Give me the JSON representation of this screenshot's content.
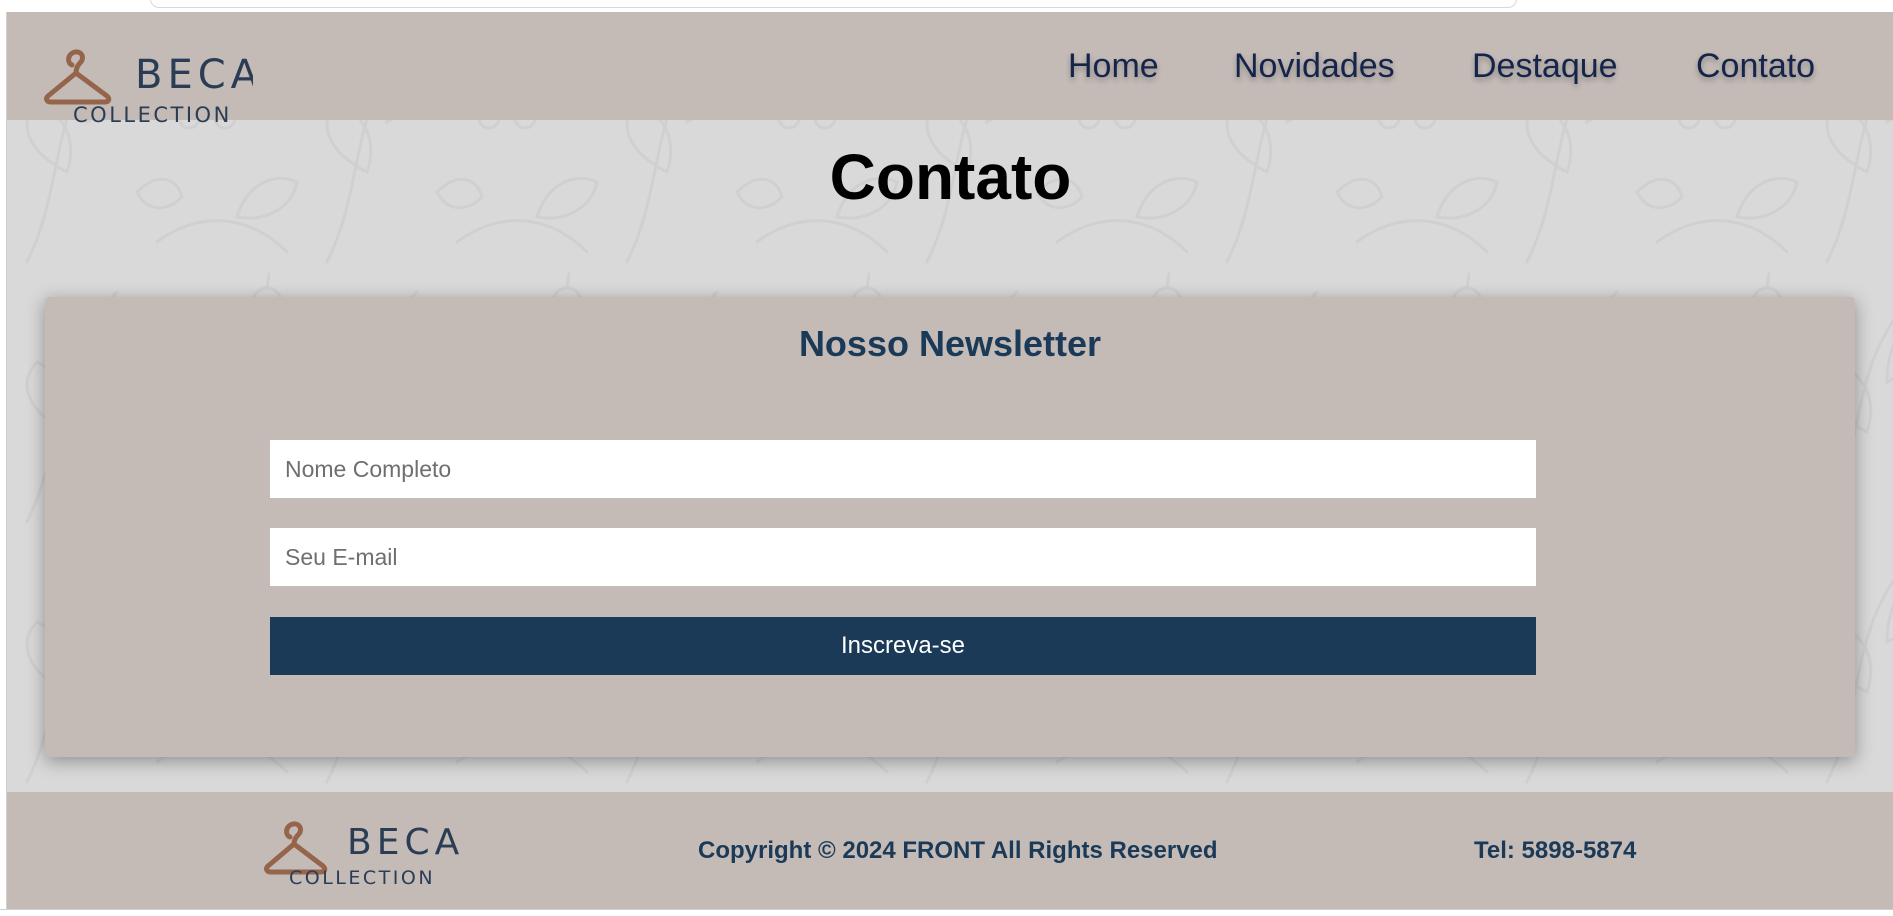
{
  "header": {
    "logo": {
      "line1": "BECA",
      "line2": "COLLECTION"
    },
    "nav": [
      "Home",
      "Novidades",
      "Destaque",
      "Contato"
    ]
  },
  "page": {
    "title": "Contato"
  },
  "newsletter": {
    "title": "Nosso Newsletter",
    "name_placeholder": "Nome Completo",
    "name_value": "",
    "email_placeholder": "Seu E-mail",
    "email_value": "",
    "submit_label": "Inscreva-se"
  },
  "footer": {
    "logo": {
      "line1": "BECA",
      "line2": "COLLECTION"
    },
    "copyright": "Copyright © 2024 FRONT All Rights Reserved",
    "phone": "Tel: 5898-5874"
  },
  "icons": {
    "logo_mark": "hanger-icon",
    "background": "floral-pattern"
  },
  "colors": {
    "header_bg": "#c4bbb7",
    "page_bg": "#d9d9d9",
    "nav_text": "#14244a",
    "accent": "#1b3a57",
    "hanger": "#95654b",
    "title": "#000000"
  }
}
